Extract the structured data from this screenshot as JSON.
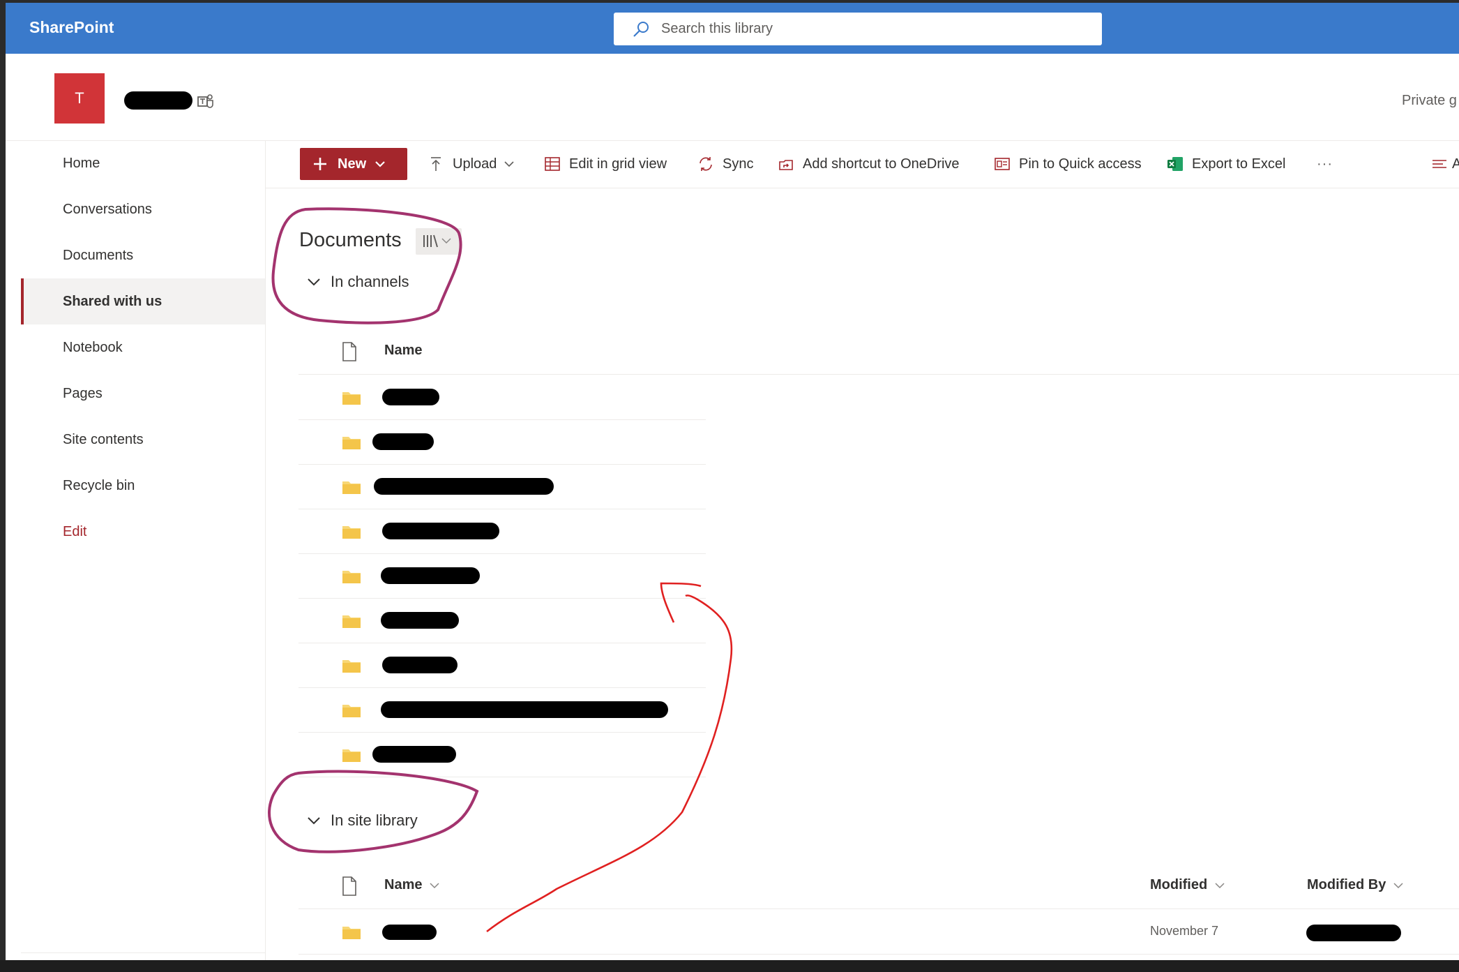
{
  "suite_bar": {
    "brand": "SharePoint",
    "search_placeholder": "Search this library",
    "icons": [
      "search-icon"
    ]
  },
  "site_header": {
    "logo_letter": "T",
    "privacy_label": "Private g",
    "icons": [
      "teams-icon"
    ]
  },
  "nav": {
    "items": [
      {
        "label": "Home"
      },
      {
        "label": "Conversations"
      },
      {
        "label": "Documents"
      },
      {
        "label": "Shared with us",
        "selected": true
      },
      {
        "label": "Notebook"
      },
      {
        "label": "Pages"
      },
      {
        "label": "Site contents"
      },
      {
        "label": "Recycle bin"
      },
      {
        "label": "Edit"
      }
    ]
  },
  "command_bar": {
    "new_label": "New",
    "upload_label": "Upload",
    "grid_label": "Edit in grid view",
    "sync_label": "Sync",
    "shortcut_label": "Add shortcut to OneDrive",
    "pin_label": "Pin to Quick access",
    "excel_label": "Export to Excel",
    "more_label": "···",
    "right_label": "A"
  },
  "library": {
    "title": "Documents",
    "channels_group": {
      "label": "In channels",
      "column_name": "Name",
      "folder_count": 9
    },
    "site_group": {
      "label": "In site library",
      "columns": {
        "name": "Name",
        "modified": "Modified",
        "modified_by": "Modified By"
      },
      "rows": [
        {
          "modified": "November 7"
        }
      ]
    }
  },
  "colors": {
    "suite_bar": "#3a7acb",
    "brand_red": "#a4262c",
    "site_logo": "#d13438",
    "annotation_circle": "#a3336e",
    "annotation_arrow": "#e02020",
    "folder": "#f8d775"
  }
}
